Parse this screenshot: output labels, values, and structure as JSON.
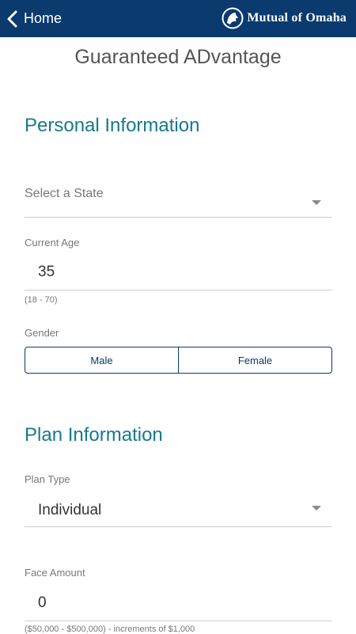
{
  "header": {
    "back_label": "Home",
    "brand": "Mutual of Omaha",
    "background": "#0a3a6e"
  },
  "page_title": "Guaranteed ADvantage",
  "personal": {
    "heading": "Personal Information",
    "state_select": {
      "placeholder": "Select a State",
      "icon": "chevron-down-icon"
    },
    "age": {
      "label": "Current Age",
      "value": "35",
      "hint": "(18 - 70)"
    },
    "gender": {
      "label": "Gender",
      "options": [
        "Male",
        "Female"
      ]
    }
  },
  "plan": {
    "heading": "Plan Information",
    "plan_type": {
      "label": "Plan Type",
      "value": "Individual",
      "icon": "chevron-down-icon"
    },
    "face_amount": {
      "label": "Face Amount",
      "value": "0",
      "hint": "($50,000 - $500,000) - increments of $1,000"
    }
  },
  "colors": {
    "accent": "#167a8a",
    "brand": "#0a3a6e"
  }
}
